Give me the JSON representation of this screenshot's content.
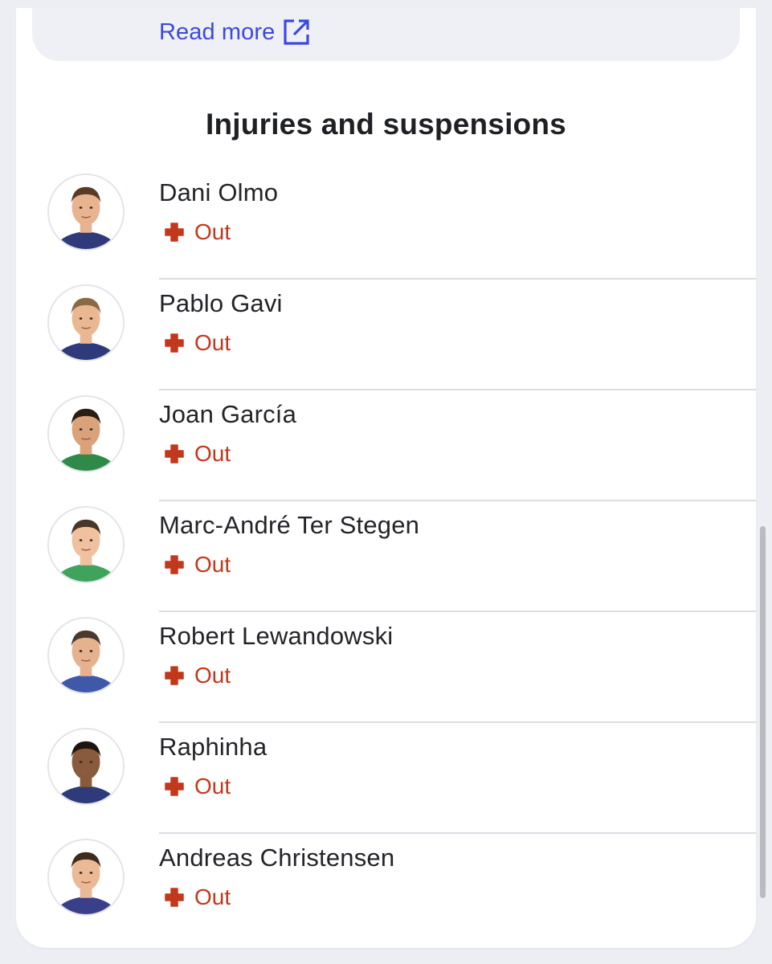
{
  "read_more": {
    "label": "Read more",
    "icon": "external-link-icon",
    "color": "#3b49df"
  },
  "section": {
    "title": "Injuries and suspensions"
  },
  "status_color": "#c2381c",
  "players": [
    {
      "name": "Dani Olmo",
      "status": "Out",
      "status_icon": "medical-cross-icon",
      "kit_color": "#2e3a7a",
      "skin": "#e8b48f",
      "hair": "#5a3a24"
    },
    {
      "name": "Pablo Gavi",
      "status": "Out",
      "status_icon": "medical-cross-icon",
      "kit_color": "#2e3a7a",
      "skin": "#e9b892",
      "hair": "#8a6a45"
    },
    {
      "name": "Joan García",
      "status": "Out",
      "status_icon": "medical-cross-icon",
      "kit_color": "#2f8a4a",
      "skin": "#d9a27a",
      "hair": "#2b1d14"
    },
    {
      "name": "Marc-André Ter Stegen",
      "status": "Out",
      "status_icon": "medical-cross-icon",
      "kit_color": "#3fa35c",
      "skin": "#efc19f",
      "hair": "#4a3626"
    },
    {
      "name": "Robert Lewandowski",
      "status": "Out",
      "status_icon": "medical-cross-icon",
      "kit_color": "#4058a8",
      "skin": "#e6b28e",
      "hair": "#4a3a2e"
    },
    {
      "name": "Raphinha",
      "status": "Out",
      "status_icon": "medical-cross-icon",
      "kit_color": "#2e3a7a",
      "skin": "#8a5a3c",
      "hair": "#1e1510"
    },
    {
      "name": "Andreas Christensen",
      "status": "Out",
      "status_icon": "medical-cross-icon",
      "kit_color": "#3a3f8a",
      "skin": "#ebb995",
      "hair": "#3f2a1c"
    }
  ]
}
